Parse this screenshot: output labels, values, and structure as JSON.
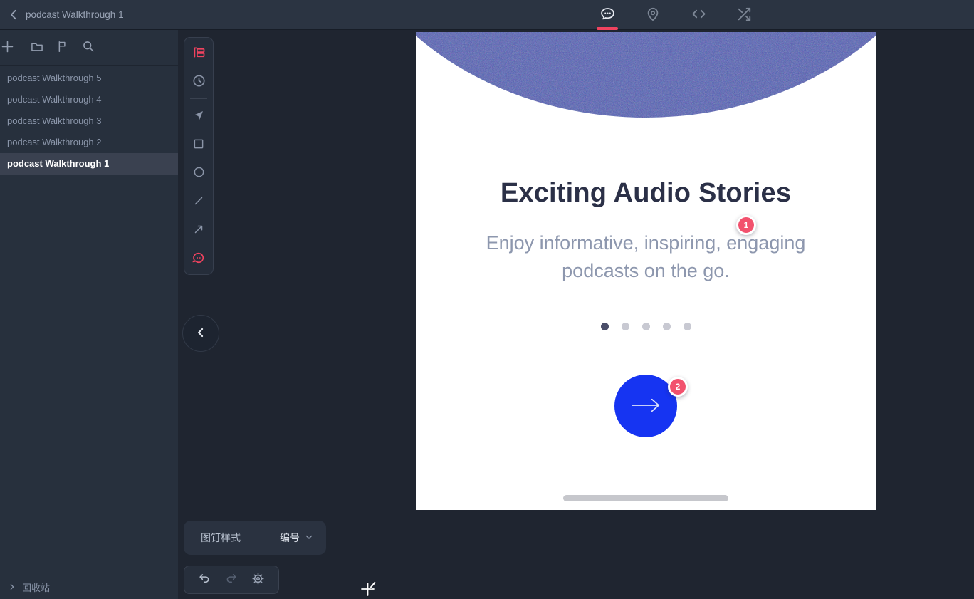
{
  "topbar": {
    "back_icon": "chevron-left",
    "title": "podcast Walkthrough 1",
    "tabs": [
      {
        "name": "comments",
        "icon": "speech-bubble",
        "active": true
      },
      {
        "name": "pins",
        "icon": "location-pin",
        "active": false
      },
      {
        "name": "code",
        "icon": "code-brackets",
        "active": false
      },
      {
        "name": "flow",
        "icon": "shuffle-arrows",
        "active": false
      }
    ]
  },
  "sidebar": {
    "tools": [
      "plus",
      "folder",
      "flag",
      "search"
    ],
    "items": [
      {
        "label": "podcast Walkthrough 5",
        "active": false
      },
      {
        "label": "podcast Walkthrough 4",
        "active": false
      },
      {
        "label": "podcast Walkthrough 3",
        "active": false
      },
      {
        "label": "podcast Walkthrough 2",
        "active": false
      },
      {
        "label": "podcast Walkthrough 1",
        "active": true
      }
    ],
    "recycle_bin_label": "回收站"
  },
  "palette": {
    "tools": [
      "pin-list (active, pink)",
      "history-clock",
      "select-cursor",
      "rectangle",
      "ellipse",
      "line",
      "arrow",
      "comment-bubble (pink)"
    ]
  },
  "pin_panel": {
    "label": "图钉样式",
    "value": "编号"
  },
  "history_panel": {
    "tools": [
      "undo",
      "redo",
      "settings"
    ]
  },
  "screen": {
    "title": "Exciting Audio Stories",
    "subtitle_line1": "Enjoy informative, inspiring, engaging",
    "subtitle_line2": "podcasts on the go.",
    "pagination": {
      "count": 5,
      "active_index": 0
    },
    "pins": [
      {
        "number": "1"
      },
      {
        "number": "2"
      }
    ],
    "next_button_icon": "arrow-right"
  },
  "colors": {
    "accent_pink": "#f0435f",
    "badge_pink": "#f2516d",
    "next_button_blue": "#1634f2",
    "hero_circle_blue": "#4c59a7",
    "topbar_bg": "#2b3442",
    "sidebar_bg": "#27303d",
    "canvas_bg": "#1f2530"
  }
}
